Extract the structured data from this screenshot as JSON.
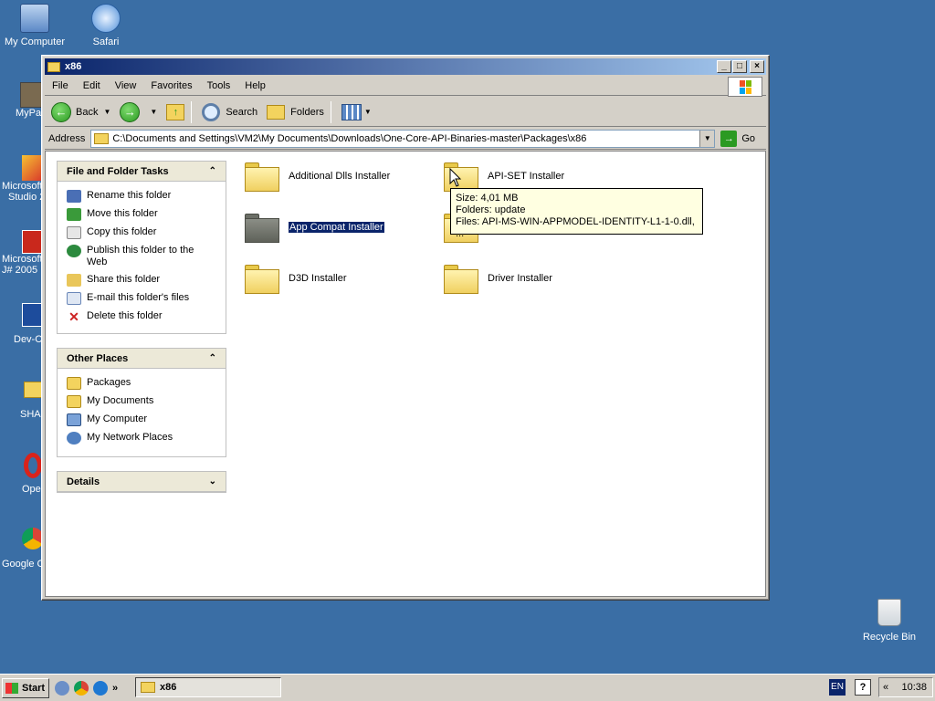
{
  "desktop": {
    "icons": [
      {
        "label": "My Computer",
        "icon": "my-computer-icon"
      },
      {
        "label": "Safari",
        "icon": "safari-icon"
      }
    ],
    "partial_labels": [
      "MyPa",
      "Microsoft",
      "Studio 2",
      "Microsoft",
      "J# 2005",
      "Dev-C",
      "SHAI",
      "Ope",
      "Google C"
    ],
    "recycle_bin": "Recycle Bin"
  },
  "window": {
    "title": "x86",
    "menu": [
      "File",
      "Edit",
      "View",
      "Favorites",
      "Tools",
      "Help"
    ],
    "toolbar": {
      "back": "Back",
      "search": "Search",
      "folders": "Folders"
    },
    "address": {
      "label": "Address",
      "value": "C:\\Documents and Settings\\VM2\\My Documents\\Downloads\\One-Core-API-Binaries-master\\Packages\\x86",
      "go": "Go"
    },
    "tasks_panel": {
      "title": "File and Folder Tasks",
      "items": [
        "Rename this folder",
        "Move this folder",
        "Copy this folder",
        "Publish this folder to the Web",
        "Share this folder",
        "E-mail this folder's files",
        "Delete this folder"
      ]
    },
    "places_panel": {
      "title": "Other Places",
      "items": [
        "Packages",
        "My Documents",
        "My Computer",
        "My Network Places"
      ]
    },
    "details_panel": {
      "title": "Details"
    },
    "folders": [
      "Additional Dlls Installer",
      "API-SET Installer",
      "App Compat Installer",
      "D3D Installer",
      "Driver Installer"
    ],
    "tooltip": {
      "size": "Size: 4,01 MB",
      "folders": "Folders: update",
      "files": "Files: API-MS-WIN-APPMODEL-IDENTITY-L1-1-0.dll, ..."
    }
  },
  "taskbar": {
    "start": "Start",
    "task": "x86",
    "lang": "EN",
    "help": "?",
    "chevron": "«",
    "quick_chevron": "»",
    "clock": "10:38"
  }
}
